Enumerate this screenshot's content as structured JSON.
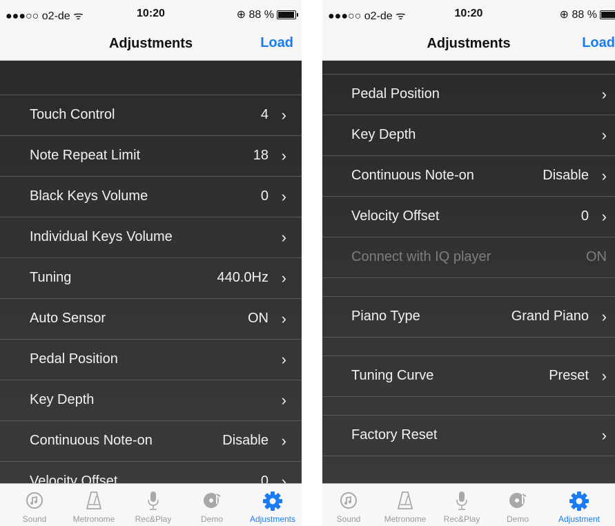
{
  "statusbar": {
    "carrier": "●●●○○ o2-de ᯤ",
    "time": "10:20",
    "battery_text": "⊕ 88 %"
  },
  "left": {
    "nav_title": "Adjustments",
    "nav_action": "Load",
    "rows": [
      {
        "label": "Touch Control",
        "value": "4"
      },
      {
        "label": "Note Repeat Limit",
        "value": "18"
      },
      {
        "label": "Black Keys Volume",
        "value": "0"
      },
      {
        "label": "Individual Keys Volume",
        "value": ""
      },
      {
        "label": "Tuning",
        "value": "440.0Hz"
      },
      {
        "label": "Auto Sensor",
        "value": "ON"
      },
      {
        "label": "Pedal Position",
        "value": ""
      },
      {
        "label": "Key Depth",
        "value": ""
      },
      {
        "label": "Continuous Note-on",
        "value": "Disable"
      },
      {
        "label": "Velocity Offset",
        "value": "0"
      }
    ]
  },
  "right": {
    "nav_title": "Adjustments",
    "nav_action": "Load",
    "rows": [
      {
        "label": "Pedal Position",
        "value": ""
      },
      {
        "label": "Key Depth",
        "value": ""
      },
      {
        "label": "Continuous Note-on",
        "value": "Disable"
      },
      {
        "label": "Velocity Offset",
        "value": "0"
      },
      {
        "label": "Connect with IQ player",
        "value": "ON"
      },
      {
        "label": "Piano Type",
        "value": "Grand Piano"
      },
      {
        "label": "Tuning Curve",
        "value": "Preset"
      },
      {
        "label": "Factory Reset",
        "value": ""
      }
    ]
  },
  "tabs_left": [
    {
      "label": "Sound",
      "icon": "sound-icon"
    },
    {
      "label": "Metronome",
      "icon": "metronome-icon"
    },
    {
      "label": "Rec&Play",
      "icon": "microphone-icon"
    },
    {
      "label": "Demo",
      "icon": "demo-disc-icon"
    },
    {
      "label": "Adjustments",
      "icon": "gear-icon"
    }
  ],
  "tabs_right": [
    {
      "label": "Sound",
      "icon": "sound-icon"
    },
    {
      "label": "Metronome",
      "icon": "metronome-icon"
    },
    {
      "label": "Rec&Play",
      "icon": "microphone-icon"
    },
    {
      "label": "Demo",
      "icon": "demo-disc-icon"
    },
    {
      "label": "Adjustment",
      "icon": "gear-icon"
    }
  ],
  "chevron": "›",
  "colors": {
    "accent": "#1a7bf2",
    "list_bg": "#2d2d2d",
    "separator": "#5a5a5a",
    "text": "#f2f2f2",
    "disabled_text": "#7e7e7e"
  }
}
